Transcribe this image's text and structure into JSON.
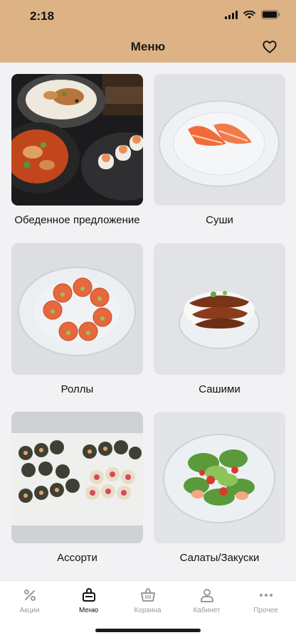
{
  "status_bar": {
    "time": "2:18"
  },
  "header": {
    "title": "Меню",
    "favorite_icon": "heart-icon"
  },
  "categories": [
    {
      "label": "Обеденное предложение",
      "image": "lunch-offer-photo"
    },
    {
      "label": "Суши",
      "image": "sushi-photo"
    },
    {
      "label": "Роллы",
      "image": "rolls-photo"
    },
    {
      "label": "Сашими",
      "image": "sashimi-photo"
    },
    {
      "label": "Ассорти",
      "image": "assorted-photo"
    },
    {
      "label": "Салаты/Закуски",
      "image": "salads-photo"
    }
  ],
  "tabbar": {
    "items": [
      {
        "label": "Акции",
        "icon": "percent-icon",
        "active": false
      },
      {
        "label": "Меню",
        "icon": "menu-bag-icon",
        "active": true
      },
      {
        "label": "Корзина",
        "icon": "basket-icon",
        "active": false
      },
      {
        "label": "Кабинет",
        "icon": "user-icon",
        "active": false
      },
      {
        "label": "Прочее",
        "icon": "more-icon",
        "active": false
      }
    ]
  },
  "colors": {
    "header_bg": "#ddb385",
    "page_bg": "#f2f2f4",
    "active_tab": "#111111",
    "inactive_tab": "#9a9a9a"
  }
}
